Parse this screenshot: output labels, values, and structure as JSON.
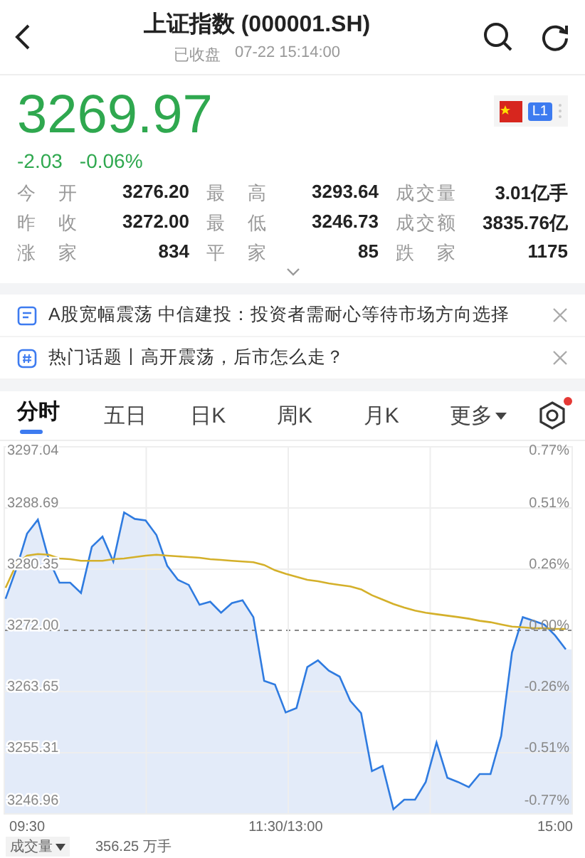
{
  "header": {
    "title": "上证指数 (000001.SH)",
    "status": "已收盘",
    "time": "07-22 15:14:00"
  },
  "quote": {
    "price": "3269.97",
    "change": "-2.03",
    "change_pct": "-0.06%",
    "badge": "L1"
  },
  "stats": [
    {
      "label": "今开",
      "value": "3276.20"
    },
    {
      "label": "最高",
      "value": "3293.64"
    },
    {
      "label": "成交量",
      "value": "3.01亿手"
    },
    {
      "label": "昨收",
      "value": "3272.00"
    },
    {
      "label": "最低",
      "value": "3246.73"
    },
    {
      "label": "成交额",
      "value": "3835.76亿"
    },
    {
      "label": "涨家",
      "value": "834"
    },
    {
      "label": "平家",
      "value": "85"
    },
    {
      "label": "跌家",
      "value": "1175"
    }
  ],
  "news": [
    {
      "kind": "article",
      "text": "A股宽幅震荡 中信建投：投资者需耐心等待市场方向选择"
    },
    {
      "kind": "topic",
      "text": "热门话题丨高开震荡，后市怎么走？"
    }
  ],
  "tabs": [
    {
      "label": "分时",
      "selected": true,
      "kind": "plain"
    },
    {
      "label": "五日",
      "selected": false,
      "kind": "plain"
    },
    {
      "label": "日K",
      "selected": false,
      "kind": "plain"
    },
    {
      "label": "周K",
      "selected": false,
      "kind": "plain"
    },
    {
      "label": "月K",
      "selected": false,
      "kind": "plain"
    },
    {
      "label": "更多",
      "selected": false,
      "kind": "menu"
    }
  ],
  "settings": {
    "notification": true
  },
  "chart": {
    "right_axis_labels": [
      "0.77%",
      "0.51%",
      "0.26%",
      "0.00%",
      "-0.26%",
      "-0.51%",
      "-0.77%"
    ],
    "chart_data": {
      "type": "line",
      "grid": true,
      "categories": [
        null,
        null,
        "09:30",
        null,
        null,
        null,
        null,
        null,
        null,
        null,
        null,
        null,
        null,
        null,
        null,
        null,
        null,
        null,
        null,
        null,
        null,
        null,
        null,
        null,
        null,
        null,
        "11:30/13:00",
        null,
        null,
        null,
        null,
        null,
        null,
        null,
        null,
        null,
        null,
        null,
        null,
        null,
        null,
        null,
        null,
        null,
        null,
        null,
        null,
        null,
        null,
        null,
        null,
        "15:00",
        null
      ],
      "series": [
        {
          "color": "#2f7be0",
          "values": [
            3276.3,
            3280.4,
            3285.2,
            3287.1,
            3281.7,
            3278.5,
            3278.5,
            3277.1,
            3283.4,
            3284.8,
            3281.4,
            3288.1,
            3287.2,
            3287.0,
            3285.0,
            3280.8,
            3278.9,
            3278.2,
            3275.5,
            3275.9,
            3274.4,
            3275.7,
            3276.1,
            3273.8,
            3265.1,
            3264.6,
            3260.8,
            3261.4,
            3267.0,
            3267.9,
            3266.5,
            3265.7,
            3262.4,
            3260.7,
            3252.8,
            3253.5,
            3247.6,
            3248.9,
            3248.9,
            3251.3,
            3256.7,
            3251.9,
            3251.3,
            3250.6,
            3252.4,
            3252.4,
            3257.6,
            3269.0,
            3273.8,
            3273.3,
            3272.8,
            3271.3,
            3269.4
          ]
        },
        {
          "color": "#d4b02a",
          "values": [
            3277.8,
            3281.0,
            3282.2,
            3282.4,
            3282.3,
            3281.8,
            3281.7,
            3281.5,
            3281.5,
            3281.5,
            3281.7,
            3281.8,
            3282.0,
            3282.2,
            3282.3,
            3282.2,
            3282.1,
            3282.0,
            3281.9,
            3281.7,
            3281.6,
            3281.5,
            3281.4,
            3281.3,
            3280.9,
            3280.2,
            3279.7,
            3279.3,
            3278.9,
            3278.7,
            3278.4,
            3278.2,
            3278.0,
            3277.6,
            3276.8,
            3276.2,
            3275.6,
            3275.1,
            3274.7,
            3274.4,
            3274.2,
            3274.0,
            3273.8,
            3273.6,
            3273.3,
            3273.1,
            3272.8,
            3272.5,
            3272.4,
            3272.3,
            3272.3,
            3272.2,
            3272.2
          ]
        }
      ],
      "ylim": [
        3246.96,
        3297.04
      ],
      "yticks": [
        3297.04,
        3288.69,
        3280.35,
        {
          "value": 3272,
          "label": "3272.00"
        },
        3263.65,
        3255.31,
        3246.96
      ]
    }
  },
  "volume": {
    "label": "成交量",
    "value": "356.25 万手"
  }
}
